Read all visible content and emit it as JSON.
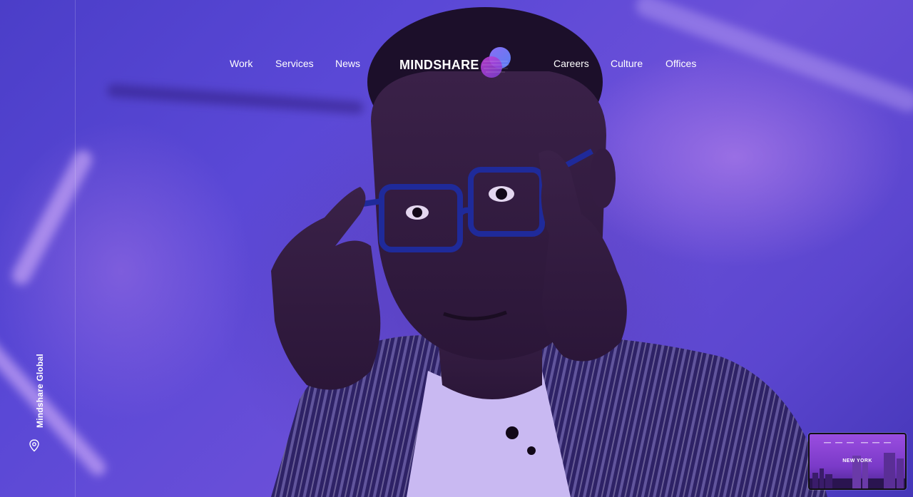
{
  "nav": {
    "left": [
      "Work",
      "Services",
      "News"
    ],
    "right": [
      "Careers",
      "Culture",
      "Offices"
    ]
  },
  "brand": {
    "name": "MINDSHARE",
    "accent_color": "#7b5cf0",
    "secondary_color": "#b33fd6"
  },
  "sidebar": {
    "label": "Mindshare Global",
    "icon": "location-pin-icon"
  },
  "location_thumbnail": {
    "city": "NEW YORK"
  },
  "hero": {
    "background_color": "#5a48d6"
  }
}
